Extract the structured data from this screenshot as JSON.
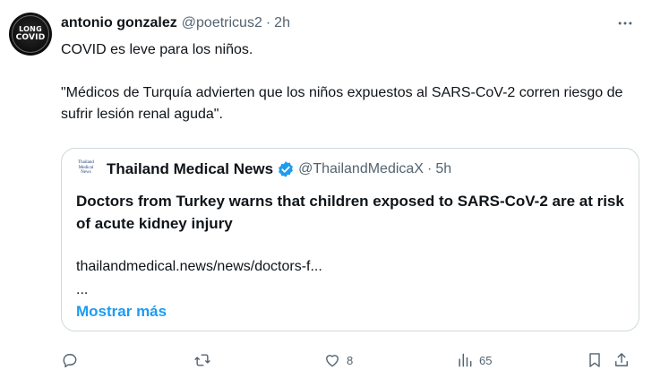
{
  "post": {
    "author_name": "antonio gonzalez",
    "handle": "@poetricus2",
    "separator": "·",
    "time": "2h",
    "avatar_text": {
      "line1": "LONG",
      "line2": "COVID"
    },
    "text_line1": "COVID es leve para los niños.",
    "text_line2": "\"Médicos de Turquía advierten que los niños expuestos al SARS-CoV-2 corren riesgo de sufrir lesión renal aguda\"."
  },
  "quote": {
    "logo_text": "Thailand Medical News",
    "name": "Thailand Medical News",
    "handle": "@ThailandMedicaX",
    "separator": "·",
    "time": "5h",
    "title": "Doctors from Turkey warns that children exposed to SARS-CoV-2 are at risk of acute kidney injury",
    "link": "thailandmedical.news/news/doctors-f...",
    "ellipsis": "...",
    "show_more": "Mostrar más",
    "verified_color": "#1d9bf0"
  },
  "actions": {
    "replies": "",
    "reposts": "",
    "likes": "8",
    "views": "65"
  },
  "colors": {
    "text": "#0f1419",
    "secondary": "#536471",
    "accent": "#1d9bf0",
    "border": "#cfd9de"
  },
  "icons": [
    "more-icon",
    "verified-icon",
    "reply-icon",
    "repost-icon",
    "like-icon",
    "views-icon",
    "bookmark-icon",
    "share-icon"
  ]
}
